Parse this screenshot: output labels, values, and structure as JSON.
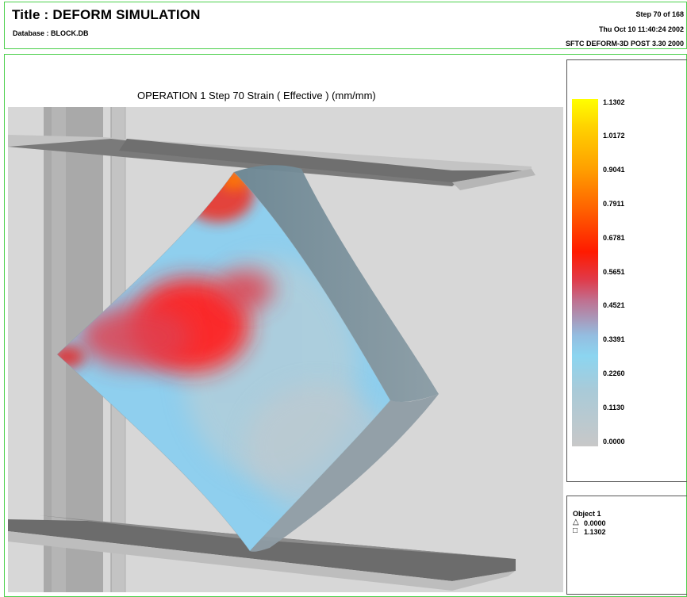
{
  "header": {
    "title": "Title : DEFORM SIMULATION",
    "database": "Database : BLOCK.DB",
    "step": "Step 70 of 168",
    "datetime": "Thu Oct 10 11:40:24 2002",
    "software": "SFTC DEFORM-3D POST 3.30 2000"
  },
  "plot": {
    "title": "OPERATION 1 Step 70  Strain ( Effective )  (mm/mm)"
  },
  "legend": {
    "ticks": [
      "1.1302",
      "1.0172",
      "0.9041",
      "0.7911",
      "0.6781",
      "0.5651",
      "0.4521",
      "0.3391",
      "0.2260",
      "0.1130",
      "0.0000"
    ],
    "colors": {
      "max": "#ffff00",
      "high": "#ff1a00",
      "mid": "#8cd5f0",
      "min": "#c8c8c8"
    }
  },
  "object": {
    "label": "Object  1",
    "min_symbol": "△",
    "min_value": "0.0000",
    "max_symbol": "□",
    "max_value": "1.1302"
  }
}
